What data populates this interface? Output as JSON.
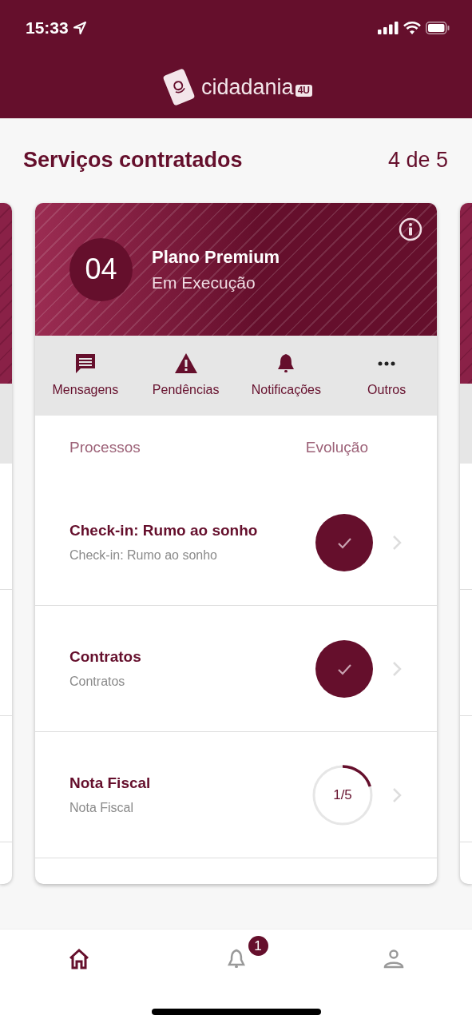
{
  "status_bar": {
    "time": "15:33"
  },
  "header": {
    "logo_text": "cidadania",
    "logo_tag": "4U"
  },
  "page": {
    "title": "Serviços contratados",
    "counter": "4 de 5"
  },
  "card": {
    "number": "04",
    "plan": "Plano Premium",
    "status": "Em Execução",
    "tabs": [
      {
        "label": "Mensagens",
        "kind": "message"
      },
      {
        "label": "Pendências",
        "kind": "warning"
      },
      {
        "label": "Notificações",
        "kind": "bell"
      },
      {
        "label": "Outros",
        "kind": "more"
      }
    ],
    "columns": [
      "Processos",
      "Evolução"
    ],
    "processes": [
      {
        "title": "Check-in: Rumo ao sonho",
        "subtitle": "Check-in: Rumo ao sonho",
        "kind": "done"
      },
      {
        "title": "Contratos",
        "subtitle": "Contratos",
        "kind": "done"
      },
      {
        "title": "Nota Fiscal",
        "subtitle": "Nota Fiscal",
        "kind": "progress",
        "reading": "1/5"
      }
    ]
  },
  "bottom_nav": [
    {
      "kind": "home",
      "selected": true
    },
    {
      "kind": "bell",
      "selected": false,
      "badge": "1"
    },
    {
      "kind": "profile",
      "selected": false
    }
  ]
}
